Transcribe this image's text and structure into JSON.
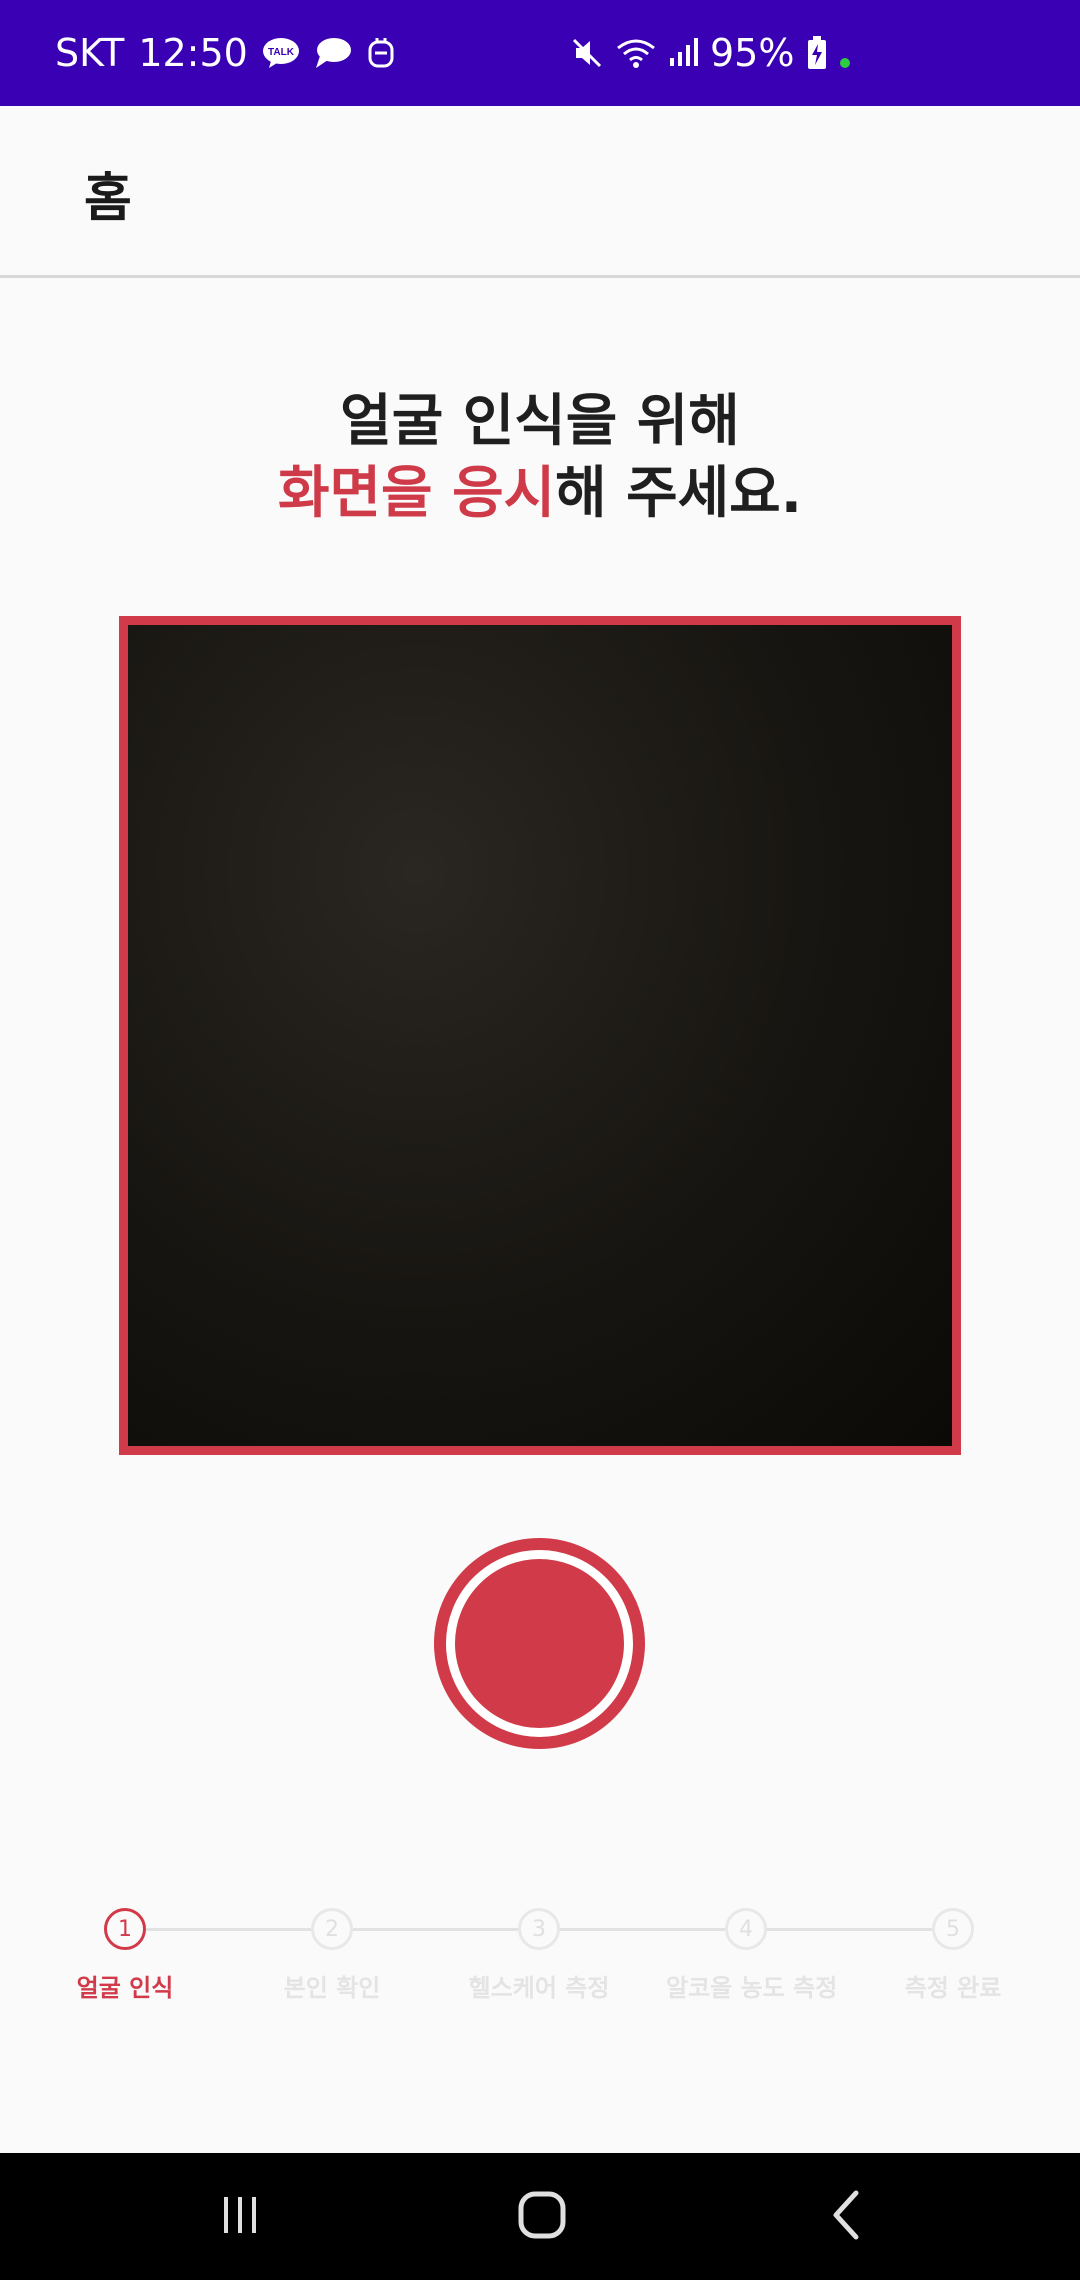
{
  "status_bar": {
    "carrier": "SKT",
    "time": "12:50",
    "battery": "95%",
    "left_icons": [
      "kakaotalk-icon",
      "chat-bubble-icon",
      "app-icon"
    ],
    "right_icons": [
      "mute-icon",
      "wifi-icon",
      "signal-icon",
      "battery-charging-icon"
    ]
  },
  "app_bar": {
    "title": "홈"
  },
  "instruction": {
    "line1": "얼굴 인식을 위해",
    "line2_accent": "화면을 응시",
    "line2_rest": "해 주세요."
  },
  "stepper": {
    "steps": [
      {
        "number": "1",
        "label": "얼굴 인식",
        "active": true
      },
      {
        "number": "2",
        "label": "본인 확인",
        "active": false
      },
      {
        "number": "3",
        "label": "헬스케어 측정",
        "active": false
      },
      {
        "number": "4",
        "label": "알코올 농도 측정",
        "active": false
      },
      {
        "number": "5",
        "label": "측정 완료",
        "active": false
      }
    ]
  },
  "colors": {
    "status_bar": "#3a00b4",
    "accent": "#d13b49",
    "background": "#fafafa"
  },
  "nav_bar": {
    "icons": [
      "recent-apps-icon",
      "home-icon",
      "back-icon"
    ]
  }
}
